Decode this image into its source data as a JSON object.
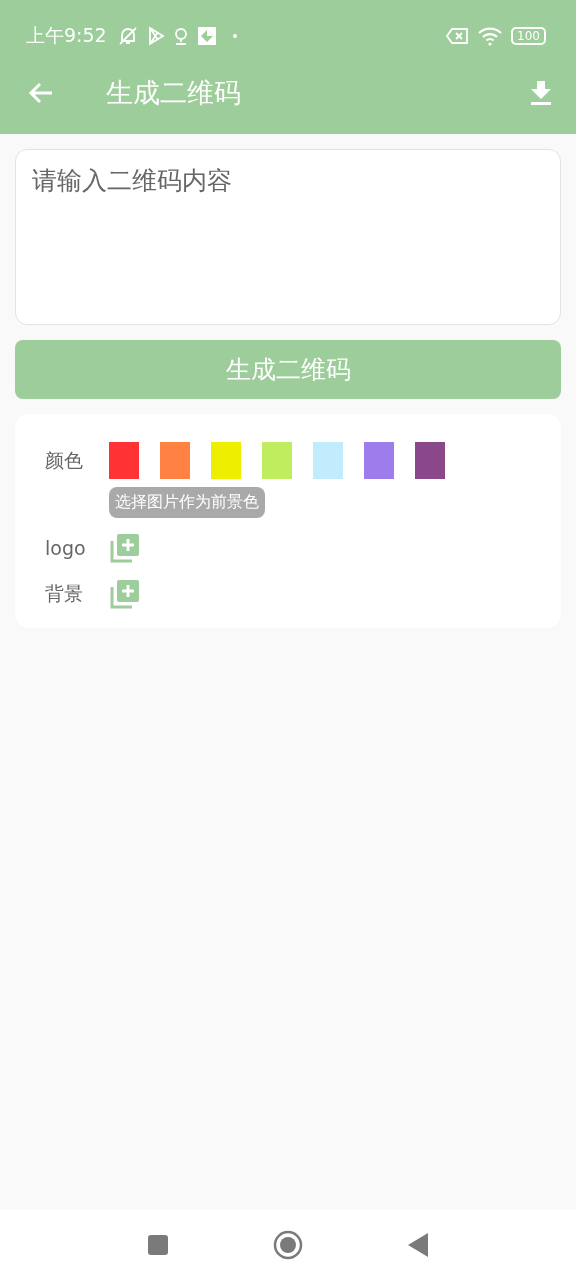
{
  "status_bar": {
    "time": "上午9:52",
    "battery": "100"
  },
  "toolbar": {
    "title": "生成二维码"
  },
  "content_field": {
    "placeholder": "请输入二维码内容"
  },
  "generate_button": "生成二维码",
  "options": {
    "color_label": "颜色",
    "colors": [
      {
        "color": "#ff3333"
      },
      {
        "color": "#ff8242"
      },
      {
        "color": "#eeee00"
      },
      {
        "color": "#c0ed5e"
      },
      {
        "color": "#c0ecfe"
      },
      {
        "color": "#9d7ceb"
      },
      {
        "color": "#8a4789"
      }
    ],
    "image_color_hint": "选择图片作为前景色",
    "logo_label": "logo",
    "background_label": "背景"
  }
}
